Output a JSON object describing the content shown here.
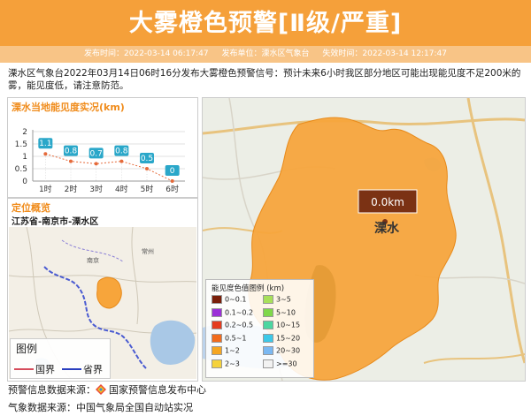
{
  "header": {
    "title": "大雾橙色预警[Ⅱ级/严重]",
    "publish_time": "发布时间：2022-03-14 06:17:47",
    "publisher": "发布单位：溧水区气象台",
    "expire_time": "失效时间：2022-03-14 12:17:47"
  },
  "description": "溧水区气象台2022年03月14日06时16分发布大雾橙色预警信号：预计未来6小时我区部分地区可能出现能见度不足200米的雾，能见度低，请注意防范。",
  "visibility_chart": {
    "panel_title": "溧水当地能见度实况(km)",
    "chart_data": {
      "type": "line",
      "categories": [
        "1时",
        "2时",
        "3时",
        "4时",
        "5时",
        "6时"
      ],
      "values": [
        1.1,
        0.8,
        0.7,
        0.8,
        0.5,
        0
      ],
      "value_labels": [
        "1.1",
        "0.8",
        "0.7",
        "0.8",
        "0.5",
        "0"
      ],
      "yticks": [
        0,
        0.5,
        1,
        1.5,
        2
      ],
      "ytick_labels": [
        "0",
        "0.5",
        "1",
        "1.5",
        "2"
      ],
      "ylim": [
        0,
        2
      ],
      "grid": true
    }
  },
  "location": {
    "panel_title": "定位概览",
    "subtitle": "江苏省-南京市-溧水区",
    "legend_title": "图例",
    "national_border": "国界",
    "province_border": "省界"
  },
  "big_map": {
    "station_label": "溧水",
    "visibility_value": "0.0km",
    "legend_title": "能见度色值图例 (km)",
    "legend_items": [
      {
        "label": "0~0.1",
        "color": "#7a1f0a"
      },
      {
        "label": "0.1~0.2",
        "color": "#9b30d8"
      },
      {
        "label": "0.2~0.5",
        "color": "#e53b1e"
      },
      {
        "label": "0.5~1",
        "color": "#f26b1d"
      },
      {
        "label": "1~2",
        "color": "#f5a623"
      },
      {
        "label": "2~3",
        "color": "#f5d23c"
      },
      {
        "label": "3~5",
        "color": "#a8e05a"
      },
      {
        "label": "5~10",
        "color": "#7fd84a"
      },
      {
        "label": "10~15",
        "color": "#4cd6a0"
      },
      {
        "label": "15~20",
        "color": "#3cc8e8"
      },
      {
        "label": "20~30",
        "color": "#7ab8f2"
      },
      {
        "label": ">=30",
        "color": "#f2f2f2"
      }
    ]
  },
  "footer": {
    "warning_source_label": "预警信息数据来源：",
    "warning_source": "国家预警信息发布中心",
    "weather_source": "气象数据来源：中国气象局全国自动站实况"
  },
  "colors": {
    "header_bg": "#f5a03a",
    "fog_orange": "#f7a53b",
    "badge": "#2aa7c9"
  }
}
